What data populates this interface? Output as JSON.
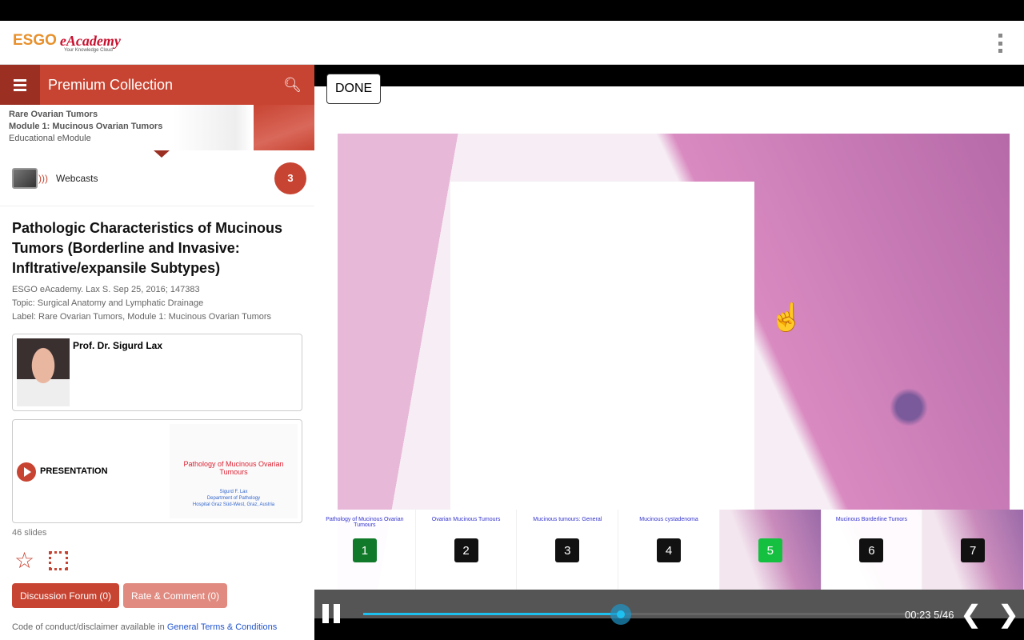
{
  "app": {
    "logo_main": "ESGO",
    "logo_sub": "eAcademy",
    "logo_tag": "Your Knowledge Cloud"
  },
  "sidebar": {
    "header_title": "Premium Collection",
    "banner": {
      "line1": "Rare Ovarian Tumors",
      "line2": "Module 1: Mucinous Ovarian Tumors",
      "line3": "Educational eModule"
    },
    "webcasts": {
      "label": "Webcasts",
      "count": "3"
    },
    "title": "Pathologic Characteristics of Mucinous Tumors (Borderline and Invasive: Infltrative/expansile Subtypes)",
    "meta": [
      "ESGO eAcademy. Lax S. Sep 25, 2016; 147383",
      "Topic: Surgical Anatomy and Lymphatic Drainage",
      "Label: Rare Ovarian Tumors, Module 1: Mucinous Ovarian Tumors"
    ],
    "author": "Prof. Dr. Sigurd Lax",
    "presentation_label": "PRESENTATION",
    "thumb_title": "Pathology of Mucinous Ovarian Tumours",
    "thumb_sub": [
      "Sigurd F. Lax",
      "Department of Pathology",
      "Hospital Graz Süd-West, Graz, Austria"
    ],
    "slides_count": "46 slides",
    "discussion": "Discussion Forum (0)",
    "rate": "Rate & Comment (0)",
    "footer_text": "Code of conduct/disclaimer available in ",
    "footer_link": "General Terms & Conditions"
  },
  "viewer": {
    "done": "DONE",
    "thumbnails": [
      {
        "n": "1",
        "title": "Pathology of Mucinous Ovarian Tumours"
      },
      {
        "n": "2",
        "title": "Ovarian Mucinous Tumours"
      },
      {
        "n": "3",
        "title": "Mucinous tumours: General"
      },
      {
        "n": "4",
        "title": "Mucinous cystadenoma"
      },
      {
        "n": "5",
        "title": ""
      },
      {
        "n": "6",
        "title": "Mucinous Borderline Tumors"
      },
      {
        "n": "7",
        "title": ""
      }
    ],
    "time": "00:23",
    "slide_pos": "5/46",
    "progress_percent": 46,
    "accent": "#1ec0f0"
  }
}
